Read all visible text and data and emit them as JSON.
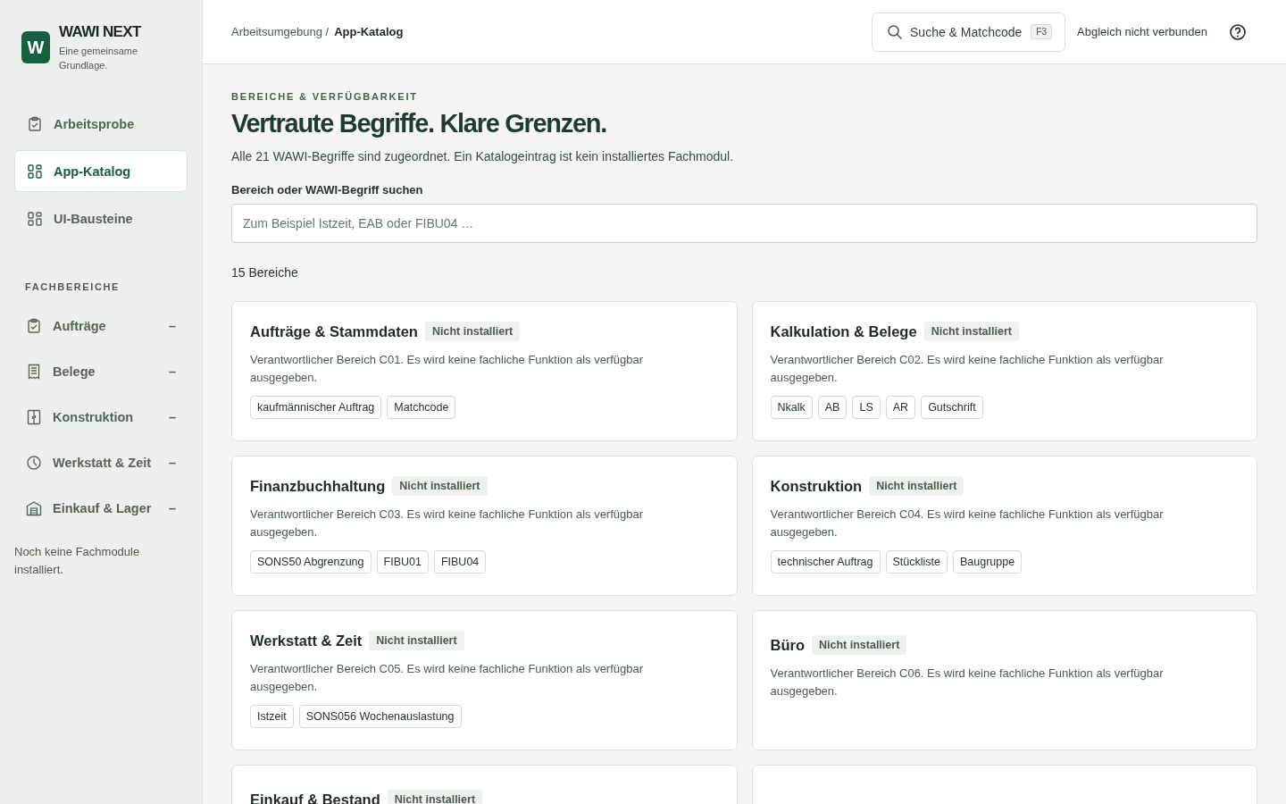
{
  "brand": {
    "logo": "W",
    "name": "WAWI NEXT",
    "tagline": "Eine gemeinsame Grundlage."
  },
  "nav": [
    {
      "label": "Arbeitsprobe",
      "kind": "clipboard",
      "selected": false
    },
    {
      "label": "App-Katalog",
      "kind": "grid",
      "selected": true
    },
    {
      "label": "UI-Bausteine",
      "kind": "grid",
      "selected": false
    }
  ],
  "areas_heading": "FACHBEREICHE",
  "areas": [
    {
      "label": "Aufträge",
      "kind": "clipboard",
      "status": "–"
    },
    {
      "label": "Belege",
      "kind": "receipt",
      "status": "–"
    },
    {
      "label": "Konstruktion",
      "kind": "cabinet",
      "status": "–"
    },
    {
      "label": "Werkstatt & Zeit",
      "kind": "clock",
      "status": "–"
    },
    {
      "label": "Einkauf & Lager",
      "kind": "warehouse",
      "status": "–"
    }
  ],
  "sidebar_note": "Noch keine Fachmodule installiert.",
  "breadcrumb": [
    "Arbeitsumgebung /",
    "App-Katalog"
  ],
  "search": {
    "label": "Suche & Matchcode",
    "key": "F3"
  },
  "sync_status": "Abgleich nicht verbunden",
  "eyebrow": "BEREICHE & VERFÜGBARKEIT",
  "title": "Vertraute Begriffe. Klare Grenzen.",
  "intro": "Alle 21 WAWI-Begriffe sind zugeordnet. Ein Katalogeintrag ist kein installiertes Fachmodul.",
  "filter": {
    "label": "Bereich oder WAWI-Begriff suchen",
    "placeholder": "Zum Beispiel Istzeit, EAB oder FIBU04 …"
  },
  "count": "15 Bereiche",
  "cards": [
    {
      "title": "Aufträge & Stammdaten",
      "badge": "Nicht installiert",
      "text": "Verantwortlicher Bereich C01. Es wird keine fachliche Funktion als verfügbar ausgegeben.",
      "tags": [
        "kaufmännischer Auftrag",
        "Matchcode"
      ]
    },
    {
      "title": "Kalkulation & Belege",
      "badge": "Nicht installiert",
      "text": "Verantwortlicher Bereich C02. Es wird keine fachliche Funktion als verfügbar ausgegeben.",
      "tags": [
        "Nkalk",
        "AB",
        "LS",
        "AR",
        "Gutschrift"
      ]
    },
    {
      "title": "Finanzbuchhaltung",
      "badge": "Nicht installiert",
      "text": "Verantwortlicher Bereich C03. Es wird keine fachliche Funktion als verfügbar ausgegeben.",
      "tags": [
        "SONS50 Abgrenzung",
        "FIBU01",
        "FIBU04"
      ]
    },
    {
      "title": "Konstruktion",
      "badge": "Nicht installiert",
      "text": "Verantwortlicher Bereich C04. Es wird keine fachliche Funktion als verfügbar ausgegeben.",
      "tags": [
        "technischer Auftrag",
        "Stückliste",
        "Baugruppe"
      ]
    },
    {
      "title": "Werkstatt & Zeit",
      "badge": "Nicht installiert",
      "text": "Verantwortlicher Bereich C05. Es wird keine fachliche Funktion als verfügbar ausgegeben.",
      "tags": [
        "Istzeit",
        "SONS056 Wochenauslastung"
      ]
    },
    {
      "title": "Büro",
      "badge": "Nicht installiert",
      "text": "Verantwortlicher Bereich C06. Es wird keine fachliche Funktion als verfügbar ausgegeben."
    },
    {
      "title": "Einkauf & Bestand",
      "badge": "Nicht installiert"
    }
  ]
}
